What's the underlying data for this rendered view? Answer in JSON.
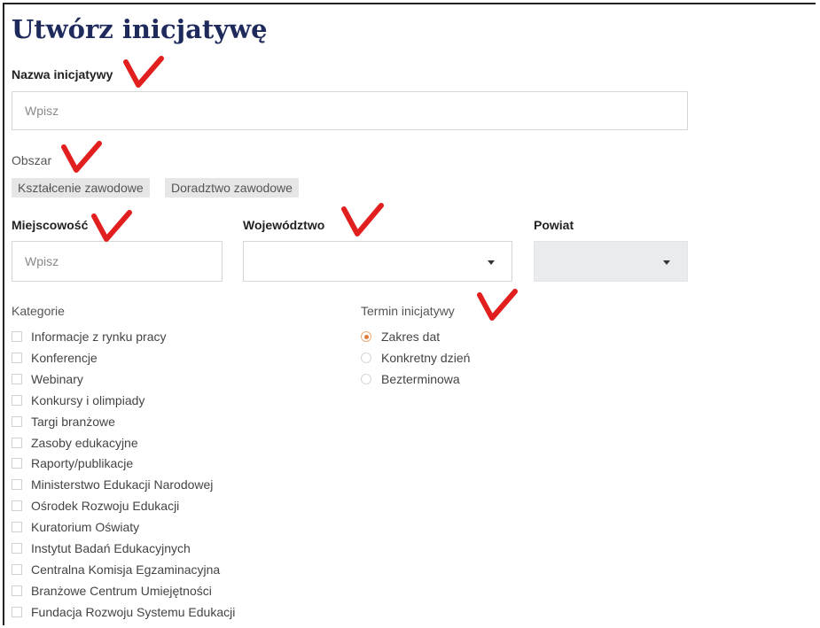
{
  "page_title": "Utwórz inicjatywę",
  "name_field": {
    "label": "Nazwa inicjatywy",
    "placeholder": "Wpisz"
  },
  "area": {
    "label": "Obszar",
    "chips": [
      "Kształcenie zawodowe",
      "Doradztwo zawodowe"
    ]
  },
  "locality": {
    "label": "Miejscowość",
    "placeholder": "Wpisz"
  },
  "voivodeship": {
    "label": "Województwo",
    "value": ""
  },
  "county": {
    "label": "Powiat",
    "value": "",
    "disabled": true
  },
  "categories": {
    "label": "Kategorie",
    "items": [
      "Informacje z rynku pracy",
      "Konferencje",
      "Webinary",
      "Konkursy i olimpiady",
      "Targi branżowe",
      "Zasoby edukacyjne",
      "Raporty/publikacje",
      "Ministerstwo Edukacji Narodowej",
      "Ośrodek Rozwoju Edukacji",
      "Kuratorium Oświaty",
      "Instytut Badań Edukacyjnych",
      "Centralna Komisja Egzaminacyjna",
      "Branżowe Centrum Umiejętności",
      "Fundacja Rozwoju Systemu Edukacji"
    ]
  },
  "term": {
    "label": "Termin inicjatywy",
    "options": [
      "Zakres dat",
      "Konkretny dzień",
      "Bezterminowa"
    ],
    "selected": "Zakres dat"
  },
  "annotation_color": "#e21f1f",
  "accent_color": "#e07b3a",
  "title_color": "#1f2a5c"
}
